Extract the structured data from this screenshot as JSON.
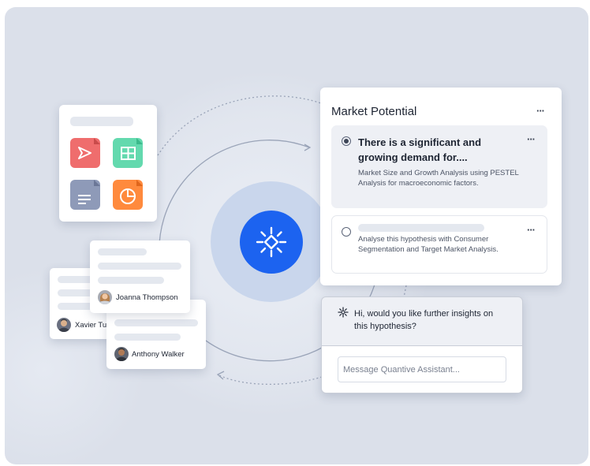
{
  "market_potential": {
    "title": "Market Potential",
    "menu_icon": "more-horizontal-icon",
    "options": [
      {
        "title": "There is a significant and growing demand for....",
        "description": "Market Size and Growth Analysis using PESTEL Analysis for macroeconomic factors.",
        "selected": true
      },
      {
        "title": "",
        "description": "Analyse this hypothesis with  Consumer Segmentation and Target Market Analysis.",
        "selected": false
      }
    ]
  },
  "assistant": {
    "icon": "sparkle-icon",
    "message": "Hi, would you like further insights on this hypothesis?",
    "input_placeholder": "Message Quantive Assistant..."
  },
  "file_icons": [
    "pdf-file-icon",
    "spreadsheet-file-icon",
    "document-file-icon",
    "chart-file-icon"
  ],
  "people": [
    "Joanna Thompson",
    "Xavier Tu",
    "Anthony Walker"
  ],
  "colors": {
    "accent": "#1c63f0",
    "background": "#dbe0ea",
    "pdf": "#ef6d6d",
    "sheet": "#63d9ae",
    "doc": "#8e9ab8",
    "chart": "#ff8a3d"
  }
}
